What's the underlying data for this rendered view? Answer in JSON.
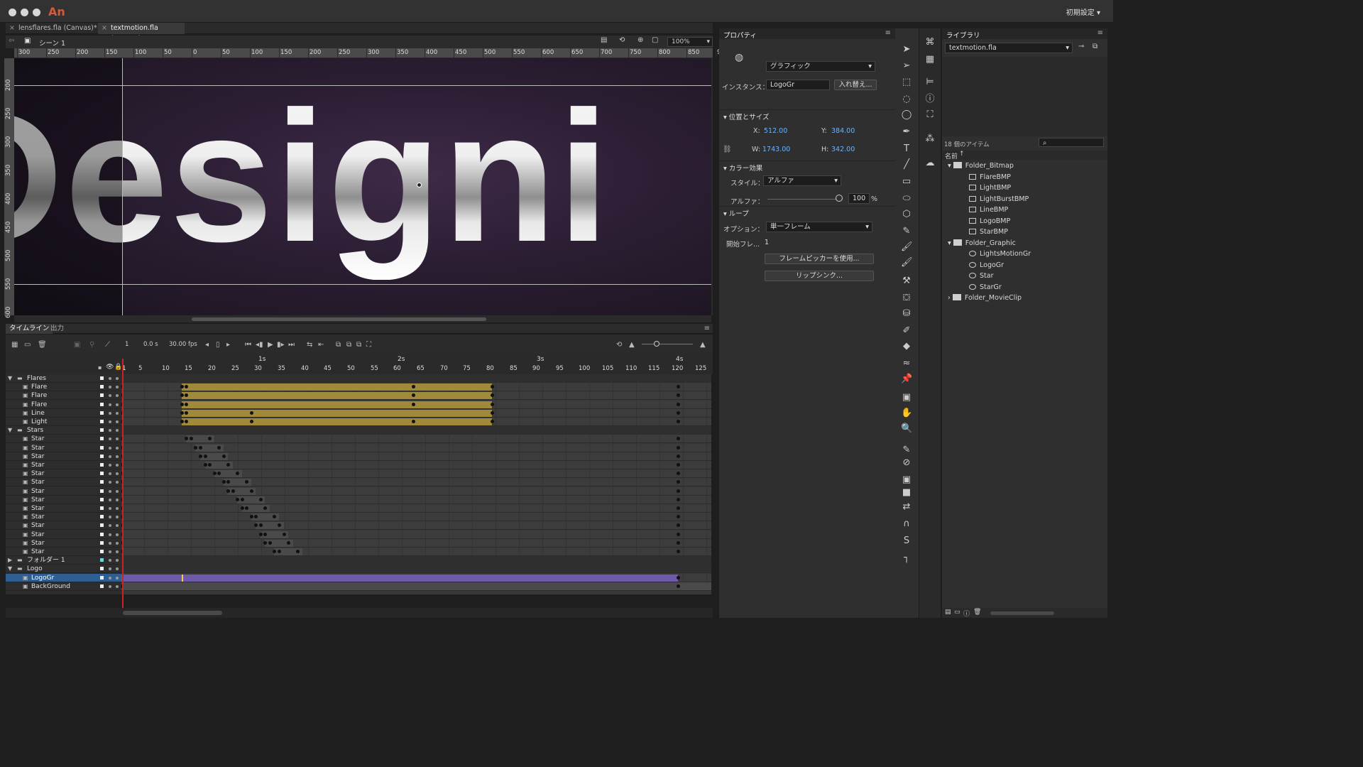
{
  "app": {
    "logo": "An",
    "workspace": "初期設定"
  },
  "tabs": [
    "lensflares.fla (Canvas)*",
    "textmotion.fla (Canvas)*"
  ],
  "stage": {
    "scene": "シーン 1",
    "zoom": "100%",
    "content_text": "Designi"
  },
  "hruler": [
    "300",
    "250",
    "200",
    "150",
    "100",
    "50",
    "0",
    "50",
    "100",
    "150",
    "200",
    "250",
    "300",
    "350",
    "400",
    "450",
    "500",
    "550",
    "600",
    "650",
    "700",
    "750",
    "800",
    "850",
    "9"
  ],
  "vruler": [
    "200",
    "250",
    "300",
    "350",
    "400",
    "450",
    "500",
    "550",
    "600"
  ],
  "timeline": {
    "tab": "タイムライン",
    "tab2": "出力",
    "frame": "1",
    "time": "0.0 s",
    "fps": "30.00 fps",
    "seconds": [
      "1s",
      "2s",
      "3s",
      "4s"
    ],
    "frame_numbers": [
      "5",
      "10",
      "15",
      "20",
      "25",
      "30",
      "35",
      "40",
      "45",
      "50",
      "55",
      "60",
      "65",
      "70",
      "75",
      "80",
      "85",
      "90",
      "95",
      "100",
      "105",
      "110",
      "115",
      "120",
      "125"
    ],
    "layers": [
      {
        "name": "Flares",
        "type": "folder"
      },
      {
        "name": "Flare",
        "type": "layer"
      },
      {
        "name": "Flare",
        "type": "layer"
      },
      {
        "name": "Flare",
        "type": "layer"
      },
      {
        "name": "Line",
        "type": "layer"
      },
      {
        "name": "Light",
        "type": "layer"
      },
      {
        "name": "Stars",
        "type": "folder"
      },
      {
        "name": "Star",
        "type": "layer"
      },
      {
        "name": "Star",
        "type": "layer"
      },
      {
        "name": "Star",
        "type": "layer"
      },
      {
        "name": "Star",
        "type": "layer"
      },
      {
        "name": "Star",
        "type": "layer"
      },
      {
        "name": "Star",
        "type": "layer"
      },
      {
        "name": "Star",
        "type": "layer"
      },
      {
        "name": "Star",
        "type": "layer"
      },
      {
        "name": "Star",
        "type": "layer"
      },
      {
        "name": "Star",
        "type": "layer"
      },
      {
        "name": "Star",
        "type": "layer"
      },
      {
        "name": "Star",
        "type": "layer"
      },
      {
        "name": "Star",
        "type": "layer"
      },
      {
        "name": "Star",
        "type": "layer"
      },
      {
        "name": "フォルダー 1",
        "type": "folder-collapsed"
      },
      {
        "name": "Logo",
        "type": "folder"
      },
      {
        "name": "LogoGr",
        "type": "layer",
        "selected": true
      },
      {
        "name": "BackGround",
        "type": "layer"
      }
    ]
  },
  "properties": {
    "title": "プロパティ",
    "symbol_type": "グラフィック",
    "instance_label": "インスタンス：",
    "instance_name": "LogoGr",
    "swap_button": "入れ替え...",
    "pos_section": "位置とサイズ",
    "x_label": "X:",
    "x": "512.00",
    "y_label": "Y:",
    "y": "384.00",
    "w_label": "W:",
    "w": "1743.00",
    "h_label": "H:",
    "h": "342.00",
    "color_section": "カラー効果",
    "style_label": "スタイル：",
    "style": "アルファ",
    "alpha_label": "アルファ：",
    "alpha": "100",
    "percent": "%",
    "loop_section": "ループ",
    "option_label": "オプション：",
    "option": "単一フレーム",
    "first_frame_label": "開始フレ...",
    "first_frame": "1",
    "frame_picker": "フレームピッカーを使用...",
    "lip_sync": "リップシンク..."
  },
  "library": {
    "title": "ライブラリ",
    "file": "textmotion.fla",
    "count": "18 個のアイテム",
    "col_name": "名前",
    "items": [
      {
        "name": "Folder_Bitmap",
        "kind": "folder",
        "depth": 0
      },
      {
        "name": "FlareBMP",
        "kind": "bitmap",
        "depth": 1
      },
      {
        "name": "LightBMP",
        "kind": "bitmap",
        "depth": 1
      },
      {
        "name": "LightBurstBMP",
        "kind": "bitmap",
        "depth": 1
      },
      {
        "name": "LineBMP",
        "kind": "bitmap",
        "depth": 1
      },
      {
        "name": "LogoBMP",
        "kind": "bitmap",
        "depth": 1
      },
      {
        "name": "StarBMP",
        "kind": "bitmap",
        "depth": 1
      },
      {
        "name": "Folder_Graphic",
        "kind": "folder",
        "depth": 0
      },
      {
        "name": "LightsMotionGr",
        "kind": "graphic",
        "depth": 1
      },
      {
        "name": "LogoGr",
        "kind": "graphic",
        "depth": 1
      },
      {
        "name": "Star",
        "kind": "graphic",
        "depth": 1
      },
      {
        "name": "StarGr",
        "kind": "graphic",
        "depth": 1
      },
      {
        "name": "Folder_MovieClip",
        "kind": "folder-collapsed",
        "depth": 0
      }
    ]
  },
  "colors": {
    "accent": "#2f5f92",
    "tween_classic": "#a08a3a",
    "tween_motion": "#6e5aa8",
    "playhead": "#cc2222",
    "value_blue": "#6bb3ff"
  }
}
